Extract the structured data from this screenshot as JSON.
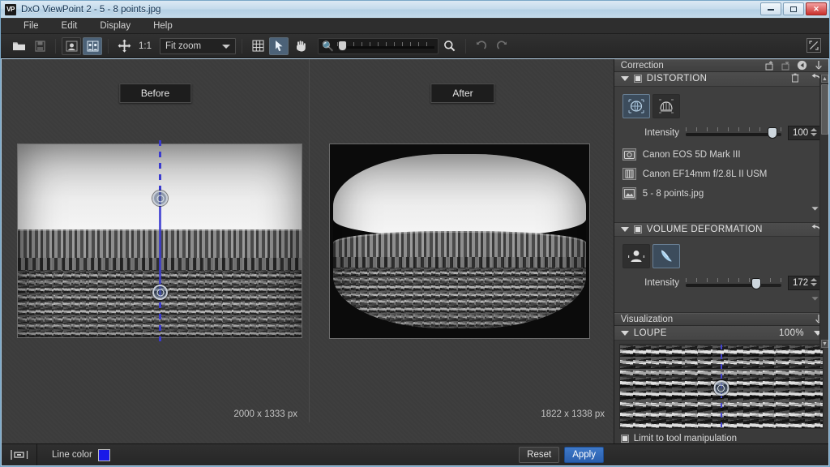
{
  "window": {
    "title": "DxO ViewPoint 2 - 5 - 8 points.jpg",
    "app_badge": "VP",
    "minimize": "–",
    "maximize": "□",
    "close": "✕"
  },
  "menubar": {
    "items": [
      "File",
      "Edit",
      "Display",
      "Help"
    ]
  },
  "toolbar": {
    "open_icon": "folder-icon",
    "save_icon": "save-icon",
    "single_view_icon": "single-view-icon",
    "compare_view_icon": "compare-view-icon",
    "pan_icon": "move-icon",
    "zoom_ratio": "1:1",
    "zoom_select_value": "Fit zoom",
    "grid_icon": "grid-icon",
    "pointer_icon": "pointer-icon",
    "hand_icon": "hand-icon",
    "zoom_out_icon": "zoom-out-icon",
    "zoom_in_icon": "zoom-in-icon",
    "undo_icon": "undo-icon",
    "redo_icon": "redo-icon",
    "fullscreen_icon": "fullscreen-icon"
  },
  "viewer": {
    "before_label": "Before",
    "after_label": "After",
    "before_dimensions": "2000 x 1333 px",
    "after_dimensions": "1822 x 1338 px"
  },
  "correction_panel": {
    "header": "Correction",
    "header_icons": [
      "export-icon",
      "import-icon",
      "reset-all-icon",
      "collapse-all-icon"
    ],
    "distortion": {
      "title": "DISTORTION",
      "enabled": true,
      "delete_icon": "trash-icon",
      "reset_icon": "undo-icon",
      "tools": [
        {
          "name": "auto-distortion-tool",
          "selected": true
        },
        {
          "name": "manual-distortion-tool",
          "selected": false
        }
      ],
      "intensity_label": "Intensity",
      "intensity_value": "100",
      "intensity_percent": 100,
      "camera": "Canon EOS 5D Mark III",
      "lens": "Canon EF14mm f/2.8L II USM",
      "file": "5 - 8 points.jpg"
    },
    "volume_deformation": {
      "title": "VOLUME DEFORMATION",
      "enabled": true,
      "reset_icon": "undo-icon",
      "tools": [
        {
          "name": "cylindrical-tool",
          "selected": false
        },
        {
          "name": "diagonal-tool",
          "selected": true
        }
      ],
      "intensity_label": "Intensity",
      "intensity_value": "172",
      "intensity_percent": 80
    }
  },
  "visualization_panel": {
    "header": "Visualization",
    "loupe": {
      "title": "LOUPE",
      "zoom_value": "100%"
    },
    "limit_checkbox_label": "Limit to tool manipulation",
    "limit_checked": true
  },
  "bottombar": {
    "view_icon": "filmstrip-icon",
    "line_color_label": "Line color",
    "line_color_value": "#1818E8",
    "reset_label": "Reset",
    "apply_label": "Apply"
  },
  "colors": {
    "accent": "#2a5fae",
    "guide_line": "#3b3bd0",
    "panel_bg": "#3a3a3a",
    "viewer_bg": "#3c3c3c"
  }
}
